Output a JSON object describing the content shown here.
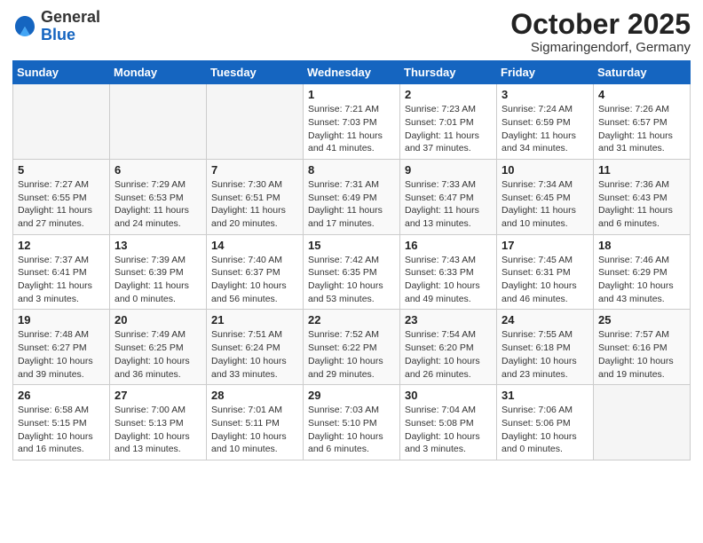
{
  "header": {
    "logo_general": "General",
    "logo_blue": "Blue",
    "month_title": "October 2025",
    "subtitle": "Sigmaringendorf, Germany"
  },
  "weekdays": [
    "Sunday",
    "Monday",
    "Tuesday",
    "Wednesday",
    "Thursday",
    "Friday",
    "Saturday"
  ],
  "weeks": [
    [
      {
        "day": "",
        "info": ""
      },
      {
        "day": "",
        "info": ""
      },
      {
        "day": "",
        "info": ""
      },
      {
        "day": "1",
        "info": "Sunrise: 7:21 AM\nSunset: 7:03 PM\nDaylight: 11 hours\nand 41 minutes."
      },
      {
        "day": "2",
        "info": "Sunrise: 7:23 AM\nSunset: 7:01 PM\nDaylight: 11 hours\nand 37 minutes."
      },
      {
        "day": "3",
        "info": "Sunrise: 7:24 AM\nSunset: 6:59 PM\nDaylight: 11 hours\nand 34 minutes."
      },
      {
        "day": "4",
        "info": "Sunrise: 7:26 AM\nSunset: 6:57 PM\nDaylight: 11 hours\nand 31 minutes."
      }
    ],
    [
      {
        "day": "5",
        "info": "Sunrise: 7:27 AM\nSunset: 6:55 PM\nDaylight: 11 hours\nand 27 minutes."
      },
      {
        "day": "6",
        "info": "Sunrise: 7:29 AM\nSunset: 6:53 PM\nDaylight: 11 hours\nand 24 minutes."
      },
      {
        "day": "7",
        "info": "Sunrise: 7:30 AM\nSunset: 6:51 PM\nDaylight: 11 hours\nand 20 minutes."
      },
      {
        "day": "8",
        "info": "Sunrise: 7:31 AM\nSunset: 6:49 PM\nDaylight: 11 hours\nand 17 minutes."
      },
      {
        "day": "9",
        "info": "Sunrise: 7:33 AM\nSunset: 6:47 PM\nDaylight: 11 hours\nand 13 minutes."
      },
      {
        "day": "10",
        "info": "Sunrise: 7:34 AM\nSunset: 6:45 PM\nDaylight: 11 hours\nand 10 minutes."
      },
      {
        "day": "11",
        "info": "Sunrise: 7:36 AM\nSunset: 6:43 PM\nDaylight: 11 hours\nand 6 minutes."
      }
    ],
    [
      {
        "day": "12",
        "info": "Sunrise: 7:37 AM\nSunset: 6:41 PM\nDaylight: 11 hours\nand 3 minutes."
      },
      {
        "day": "13",
        "info": "Sunrise: 7:39 AM\nSunset: 6:39 PM\nDaylight: 11 hours\nand 0 minutes."
      },
      {
        "day": "14",
        "info": "Sunrise: 7:40 AM\nSunset: 6:37 PM\nDaylight: 10 hours\nand 56 minutes."
      },
      {
        "day": "15",
        "info": "Sunrise: 7:42 AM\nSunset: 6:35 PM\nDaylight: 10 hours\nand 53 minutes."
      },
      {
        "day": "16",
        "info": "Sunrise: 7:43 AM\nSunset: 6:33 PM\nDaylight: 10 hours\nand 49 minutes."
      },
      {
        "day": "17",
        "info": "Sunrise: 7:45 AM\nSunset: 6:31 PM\nDaylight: 10 hours\nand 46 minutes."
      },
      {
        "day": "18",
        "info": "Sunrise: 7:46 AM\nSunset: 6:29 PM\nDaylight: 10 hours\nand 43 minutes."
      }
    ],
    [
      {
        "day": "19",
        "info": "Sunrise: 7:48 AM\nSunset: 6:27 PM\nDaylight: 10 hours\nand 39 minutes."
      },
      {
        "day": "20",
        "info": "Sunrise: 7:49 AM\nSunset: 6:25 PM\nDaylight: 10 hours\nand 36 minutes."
      },
      {
        "day": "21",
        "info": "Sunrise: 7:51 AM\nSunset: 6:24 PM\nDaylight: 10 hours\nand 33 minutes."
      },
      {
        "day": "22",
        "info": "Sunrise: 7:52 AM\nSunset: 6:22 PM\nDaylight: 10 hours\nand 29 minutes."
      },
      {
        "day": "23",
        "info": "Sunrise: 7:54 AM\nSunset: 6:20 PM\nDaylight: 10 hours\nand 26 minutes."
      },
      {
        "day": "24",
        "info": "Sunrise: 7:55 AM\nSunset: 6:18 PM\nDaylight: 10 hours\nand 23 minutes."
      },
      {
        "day": "25",
        "info": "Sunrise: 7:57 AM\nSunset: 6:16 PM\nDaylight: 10 hours\nand 19 minutes."
      }
    ],
    [
      {
        "day": "26",
        "info": "Sunrise: 6:58 AM\nSunset: 5:15 PM\nDaylight: 10 hours\nand 16 minutes."
      },
      {
        "day": "27",
        "info": "Sunrise: 7:00 AM\nSunset: 5:13 PM\nDaylight: 10 hours\nand 13 minutes."
      },
      {
        "day": "28",
        "info": "Sunrise: 7:01 AM\nSunset: 5:11 PM\nDaylight: 10 hours\nand 10 minutes."
      },
      {
        "day": "29",
        "info": "Sunrise: 7:03 AM\nSunset: 5:10 PM\nDaylight: 10 hours\nand 6 minutes."
      },
      {
        "day": "30",
        "info": "Sunrise: 7:04 AM\nSunset: 5:08 PM\nDaylight: 10 hours\nand 3 minutes."
      },
      {
        "day": "31",
        "info": "Sunrise: 7:06 AM\nSunset: 5:06 PM\nDaylight: 10 hours\nand 0 minutes."
      },
      {
        "day": "",
        "info": ""
      }
    ]
  ]
}
